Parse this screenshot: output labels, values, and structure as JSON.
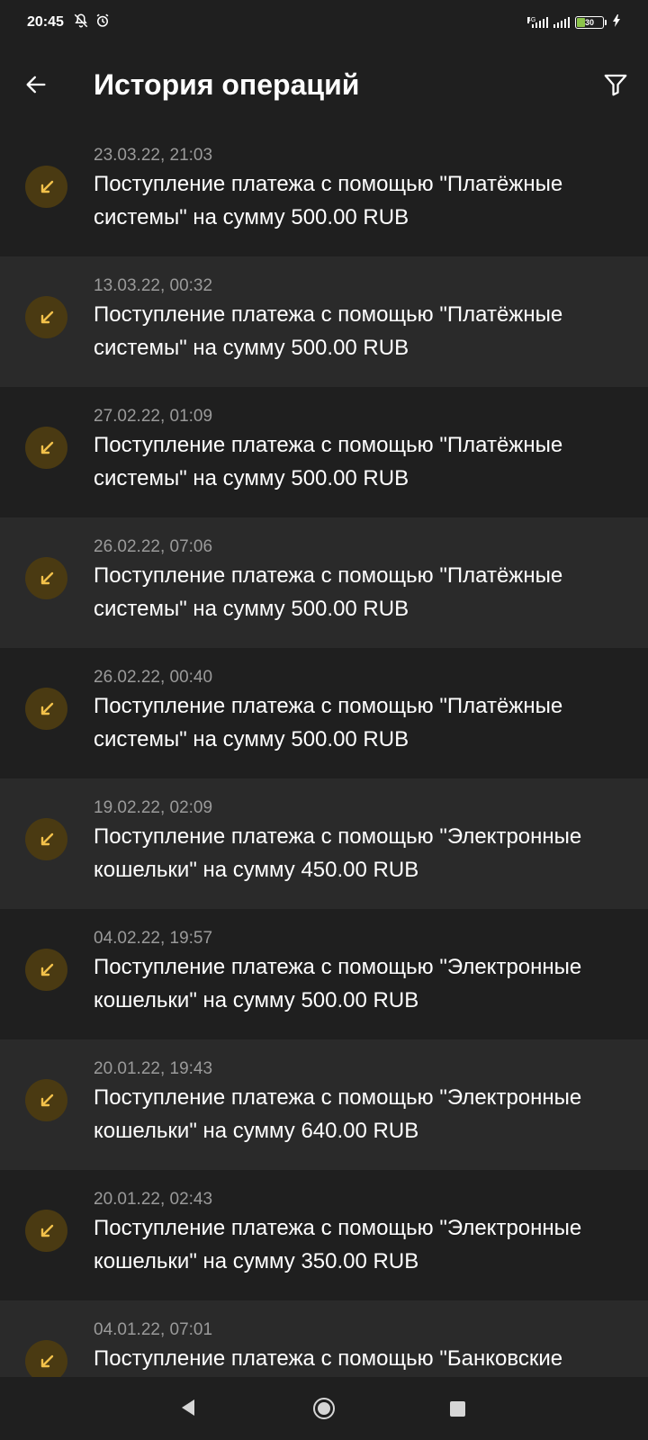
{
  "status_bar": {
    "time": "20:45",
    "left_icons": [
      "notifications-off-icon",
      "alarm-icon"
    ],
    "network_label": "4G",
    "battery_level": "30",
    "battery_percent": 30
  },
  "header": {
    "title": "История операций",
    "back_icon": "arrow-left-icon",
    "filter_icon": "filter-icon"
  },
  "operations": [
    {
      "date": "23.03.22, 21:03",
      "text": "Поступление платежа с помощью \"Платёжные системы\" на сумму 500.00 RUB"
    },
    {
      "date": "13.03.22, 00:32",
      "text": "Поступление платежа с помощью \"Платёжные системы\" на сумму 500.00 RUB"
    },
    {
      "date": "27.02.22, 01:09",
      "text": "Поступление платежа с помощью \"Платёжные системы\" на сумму 500.00 RUB"
    },
    {
      "date": "26.02.22, 07:06",
      "text": "Поступление платежа с помощью \"Платёжные системы\" на сумму 500.00 RUB"
    },
    {
      "date": "26.02.22, 00:40",
      "text": "Поступление платежа с помощью \"Платёжные системы\" на сумму 500.00 RUB"
    },
    {
      "date": "19.02.22, 02:09",
      "text": "Поступление платежа с помощью \"Электронные кошельки\" на сумму 450.00 RUB"
    },
    {
      "date": "04.02.22, 19:57",
      "text": "Поступление платежа с помощью \"Электронные кошельки\" на сумму 500.00 RUB"
    },
    {
      "date": "20.01.22, 19:43",
      "text": "Поступление платежа с помощью \"Электронные кошельки\" на сумму 640.00 RUB"
    },
    {
      "date": "20.01.22, 02:43",
      "text": "Поступление платежа с помощью \"Электронные кошельки\" на сумму 350.00 RUB"
    },
    {
      "date": "04.01.22, 07:01",
      "text": "Поступление платежа с помощью \"Банковские"
    }
  ],
  "colors": {
    "background": "#1f1f1f",
    "row_alt": "#2a2a2a",
    "icon_bg": "#4a3a12",
    "icon_arrow": "#f2c14a",
    "date_text": "#9a9a9a"
  },
  "nav_bar": {
    "back_icon": "nav-back-triangle-icon",
    "home_icon": "nav-home-circle-icon",
    "recent_icon": "nav-recent-square-icon"
  }
}
